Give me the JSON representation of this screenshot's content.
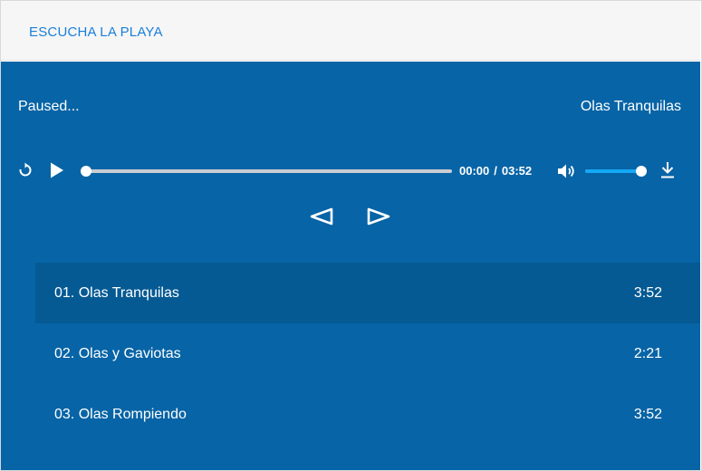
{
  "header": {
    "title": "ESCUCHA LA PLAYA"
  },
  "player": {
    "status": "Paused...",
    "now_playing": "Olas Tranquilas",
    "current_time": "00:00",
    "time_separator": "/",
    "duration": "03:52",
    "progress_fraction": 0.0,
    "volume_fraction": 1.0,
    "icons": {
      "replay": "replay-icon",
      "play": "play-icon",
      "volume": "volume-icon",
      "download": "download-icon",
      "previous": "previous-icon",
      "next": "next-icon"
    }
  },
  "playlist": [
    {
      "name": "01. Olas Tranquilas",
      "duration": "3:52",
      "active": true
    },
    {
      "name": "02. Olas y Gaviotas",
      "duration": "2:21",
      "active": false
    },
    {
      "name": "03. Olas Rompiendo",
      "duration": "3:52",
      "active": false
    }
  ],
  "colors": {
    "header_bg": "#f6f6f6",
    "header_text": "#1a7fd9",
    "player_bg": "#0764a6",
    "active_track_bg": "#055a93",
    "volume_fill": "#13a8f5"
  }
}
